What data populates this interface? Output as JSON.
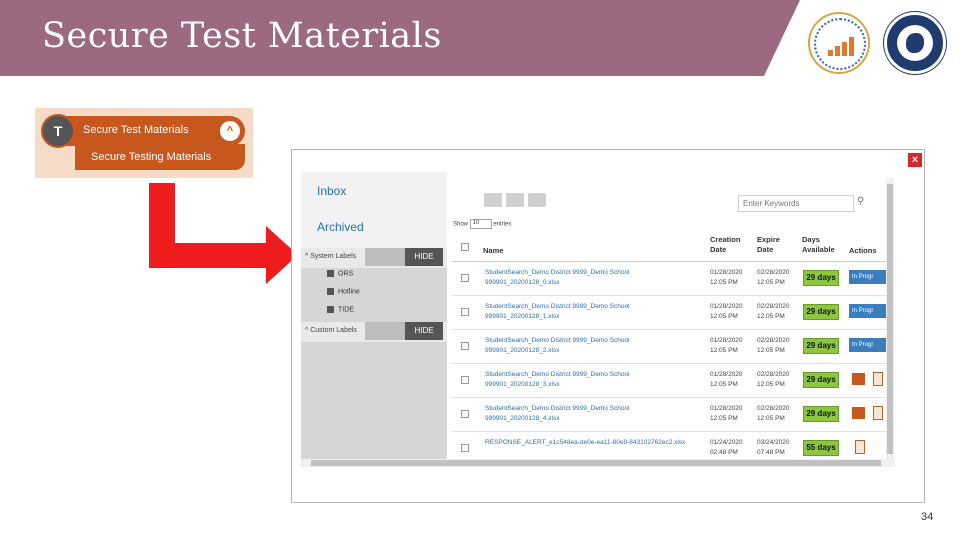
{
  "slide": {
    "title": "Secure Test Materials",
    "page_number": "34",
    "accent_color": "#9b6a80"
  },
  "menu": {
    "icon_text": "T",
    "top_label": "Secure Test Materials",
    "chevron": "^",
    "sub_label": "Secure Testing Materials",
    "color": "#c7571d"
  },
  "modal": {
    "close": "×",
    "sidebar": {
      "inbox": "Inbox",
      "archived": "Archived",
      "system_labels": "^ System Labels",
      "hide_label": "HIDE",
      "items": [
        "ORS",
        "Hotline",
        "TIDE"
      ],
      "custom_labels": "^ Custom Labels"
    },
    "toolbar": {
      "search_placeholder": "Enter Keywords",
      "show_prefix": "Show",
      "show_value": "10",
      "show_suffix": "entries"
    },
    "columns": [
      "Name",
      "Creation Date",
      "Expire Date",
      "Days Available",
      "Actions"
    ],
    "rows": [
      {
        "name": "StudentSearch_Demo District 9999_Demo School 999901_20200128_0.xlsx",
        "created": "01/28/2020 12:05 PM",
        "expires": "02/28/2020 12:05 PM",
        "days": "29 days",
        "action": "In Progr",
        "status": "in-progress"
      },
      {
        "name": "StudentSearch_Demo District 9999_Demo School 999901_20200128_1.xlsx",
        "created": "01/28/2020 12:05 PM",
        "expires": "02/28/2020 12:05 PM",
        "days": "29 days",
        "action": "In Progr",
        "status": "in-progress"
      },
      {
        "name": "StudentSearch_Demo District 9999_Demo School 999901_20200128_2.xlsx",
        "created": "01/28/2020 12:05 PM",
        "expires": "02/28/2020 12:05 PM",
        "days": "29 days",
        "action": "In Progr",
        "status": "in-progress"
      },
      {
        "name": "StudentSearch_Demo District 9999_Demo School 999901_20200128_3.xlsx",
        "created": "01/28/2020 12:05 PM",
        "expires": "02/28/2020 12:05 PM",
        "days": "29 days",
        "action": "",
        "status": "complete"
      },
      {
        "name": "StudentSearch_Demo District 9999_Demo School 999901_20200128_4.xlsx",
        "created": "01/28/2020 12:05 PM",
        "expires": "02/28/2020 12:05 PM",
        "days": "29 days",
        "action": "",
        "status": "complete"
      },
      {
        "name": "RESPONSE_ALERT_e1c548ea-de0e-ea11-80e9-843102762ec2.xlsx",
        "created": "01/24/2020 02:48 PM",
        "expires": "03/24/2020 07:48 PM",
        "days": "55 days",
        "action": "",
        "status": "trash-only"
      }
    ]
  }
}
